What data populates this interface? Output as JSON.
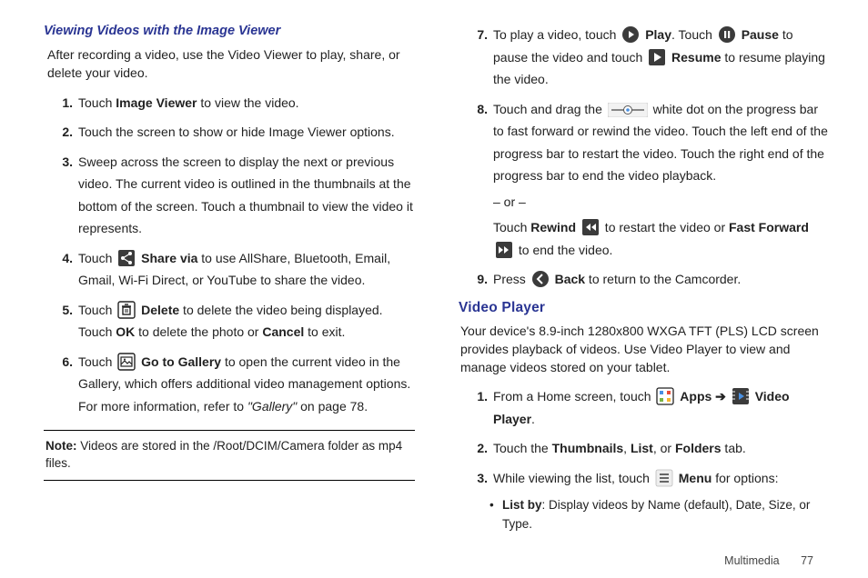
{
  "left": {
    "heading": "Viewing Videos with the Image Viewer",
    "intro": "After recording a video, use the Video Viewer to play, share, or delete your video.",
    "s1a": "Touch ",
    "s1b": "Image Viewer",
    "s1c": " to view the video.",
    "s2": "Touch the screen to show or hide Image Viewer options.",
    "s3": "Sweep across the screen to display the next or previous video. The current video is outlined in the thumbnails at the bottom of the screen. Touch a thumbnail to view the video it represents.",
    "s4a": "Touch ",
    "s4b": "Share via",
    "s4c": " to use AllShare, Bluetooth, Email, Gmail, Wi-Fi Direct, or YouTube to share the video.",
    "s5a": "Touch ",
    "s5b": "Delete",
    "s5c": " to delete the video being displayed. Touch ",
    "s5d": "OK",
    "s5e": " to delete the photo or ",
    "s5f": "Cancel",
    "s5g": " to exit.",
    "s6a": "Touch ",
    "s6b": "Go to Gallery",
    "s6c": " to open the current video in the Gallery, which offers additional video management options. For more information, refer to ",
    "s6d": "\"Gallery\"",
    "s6e": "  on page 78.",
    "noteLabel": "Note:",
    "noteText": " Videos are stored in the /Root/DCIM/Camera folder as mp4 files."
  },
  "right": {
    "s7a": "To play a video, touch ",
    "s7b": "Play",
    "s7c": ". Touch ",
    "s7d": "Pause",
    "s7e": " to pause the video and touch ",
    "s7f": "Resume",
    "s7g": " to resume playing the video.",
    "s8a": "Touch and drag the ",
    "s8b": " white dot on the progress bar to fast forward or rewind the video. Touch the left end of the progress bar to restart the video. Touch the right end of the progress bar to end the video playback.",
    "s8or": "– or –",
    "s8c": "Touch ",
    "s8d": "Rewind",
    "s8e": " to restart the video or ",
    "s8f": "Fast Forward",
    "s8g": " to end the video.",
    "s9a": "Press ",
    "s9b": "Back",
    "s9c": " to return to the Camcorder.",
    "section": "Video Player",
    "intro": "Your device's 8.9-inch 1280x800 WXGA TFT (PLS) LCD screen provides playback of videos. Use Video Player to view and manage videos stored on your tablet.",
    "p1a": "From a Home screen, touch ",
    "p1b": "Apps",
    "p1arrow": " ➔ ",
    "p1c": "Video Player",
    "p1d": ".",
    "p2a": "Touch the ",
    "p2b": "Thumbnails",
    "p2c": ", ",
    "p2d": "List",
    "p2e": ", or ",
    "p2f": "Folders",
    "p2g": " tab.",
    "p3a": "While viewing the list, touch ",
    "p3b": "Menu",
    "p3c": " for options:",
    "bulletLabel": "List by",
    "bulletText": ": Display videos by Name (default), Date, Size, or Type."
  },
  "footer": {
    "section": "Multimedia",
    "page": "77"
  }
}
